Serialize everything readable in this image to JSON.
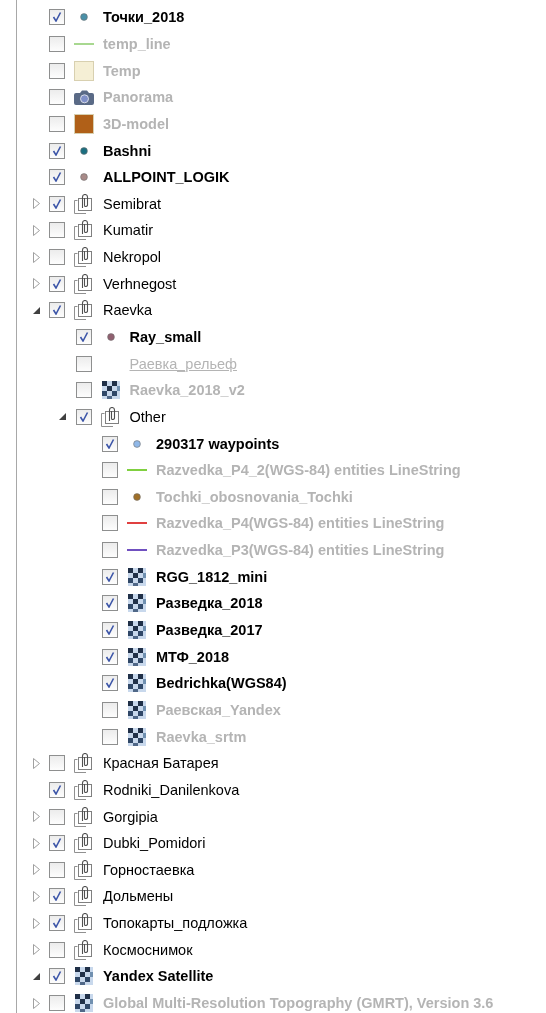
{
  "layers": [
    {
      "label": "Точки_2018",
      "kind": "point",
      "color": "#4a90a8",
      "checked": true
    },
    {
      "label": "temp_line",
      "kind": "line",
      "color": "#a8d890",
      "checked": false
    },
    {
      "label": "Temp",
      "kind": "fill",
      "color": "#f5efd5",
      "checked": false
    },
    {
      "label": "Panorama",
      "kind": "camera",
      "checked": false
    },
    {
      "label": "3D-model",
      "kind": "fill",
      "color": "#b06018",
      "checked": false
    },
    {
      "label": "Bashni",
      "kind": "point",
      "color": "#1a6e80",
      "checked": true
    },
    {
      "label": "ALLPOINT_LOGIK",
      "kind": "point",
      "color": "#a88a88",
      "checked": true
    },
    {
      "label": "Semibrat",
      "kind": "group",
      "checked": true,
      "expanded": false
    },
    {
      "label": "Kumatir",
      "kind": "group",
      "checked": false,
      "expanded": false
    },
    {
      "label": "Nekropol",
      "kind": "group",
      "checked": false,
      "expanded": false
    },
    {
      "label": "Verhnegost",
      "kind": "group",
      "checked": true,
      "expanded": false
    },
    {
      "label": "Raevka",
      "kind": "group",
      "checked": true,
      "expanded": true,
      "children": [
        {
          "label": "Ray_small",
          "kind": "point",
          "color": "#906070",
          "checked": true
        },
        {
          "label": "Раевка_рельеф",
          "kind": "none",
          "underlined": true,
          "checked": false
        },
        {
          "label": "Raevka_2018_v2",
          "kind": "raster",
          "checked": false
        },
        {
          "label": "Other",
          "kind": "group",
          "checked": true,
          "expanded": true,
          "children": [
            {
              "label": "290317 waypoints",
              "kind": "point",
              "color": "#90b8e8",
              "checked": true
            },
            {
              "label": "Razvedka_P4_2(WGS-84) entities LineString",
              "kind": "line",
              "color": "#80d040",
              "checked": false
            },
            {
              "label": "Tochki_obosnovania_Tochki",
              "kind": "point",
              "color": "#a07028",
              "checked": false
            },
            {
              "label": "Razvedka_P4(WGS-84) entities LineString",
              "kind": "line",
              "color": "#e04040",
              "checked": false
            },
            {
              "label": "Razvedka_P3(WGS-84) entities LineString",
              "kind": "line",
              "color": "#7050c0",
              "checked": false
            },
            {
              "label": "RGG_1812_mini",
              "kind": "raster",
              "checked": true
            },
            {
              "label": "Разведка_2018",
              "kind": "raster",
              "checked": true
            },
            {
              "label": "Разведка_2017",
              "kind": "raster",
              "checked": true
            },
            {
              "label": "МТФ_2018",
              "kind": "raster",
              "checked": true
            },
            {
              "label": "Bedrichka(WGS84)",
              "kind": "raster",
              "checked": true
            },
            {
              "label": "Раевская_Yandex",
              "kind": "raster",
              "checked": false
            },
            {
              "label": "Raevka_srtm",
              "kind": "raster",
              "checked": false
            }
          ]
        }
      ]
    },
    {
      "label": "Красная Батарея",
      "kind": "group",
      "checked": false,
      "expanded": false
    },
    {
      "label": "Rodniki_Danilenkova",
      "kind": "group",
      "checked": true
    },
    {
      "label": "Gorgipia",
      "kind": "group",
      "checked": false,
      "expanded": false
    },
    {
      "label": "Dubki_Pomidori",
      "kind": "group",
      "checked": true,
      "expanded": false
    },
    {
      "label": "Горностаевка",
      "kind": "group",
      "checked": false,
      "expanded": false
    },
    {
      "label": "Дольмены",
      "kind": "group",
      "checked": true,
      "expanded": false
    },
    {
      "label": "Топокарты_подложка",
      "kind": "group",
      "checked": true,
      "expanded": false
    },
    {
      "label": "Космоснимок",
      "kind": "group",
      "checked": false,
      "expanded": false
    },
    {
      "label": "Yandex Satellite",
      "kind": "raster",
      "checked": true,
      "expanded": true
    },
    {
      "label": "Global Multi-Resolution Topography (GMRT), Version 3.6",
      "kind": "raster",
      "checked": false,
      "expanded": false
    }
  ]
}
